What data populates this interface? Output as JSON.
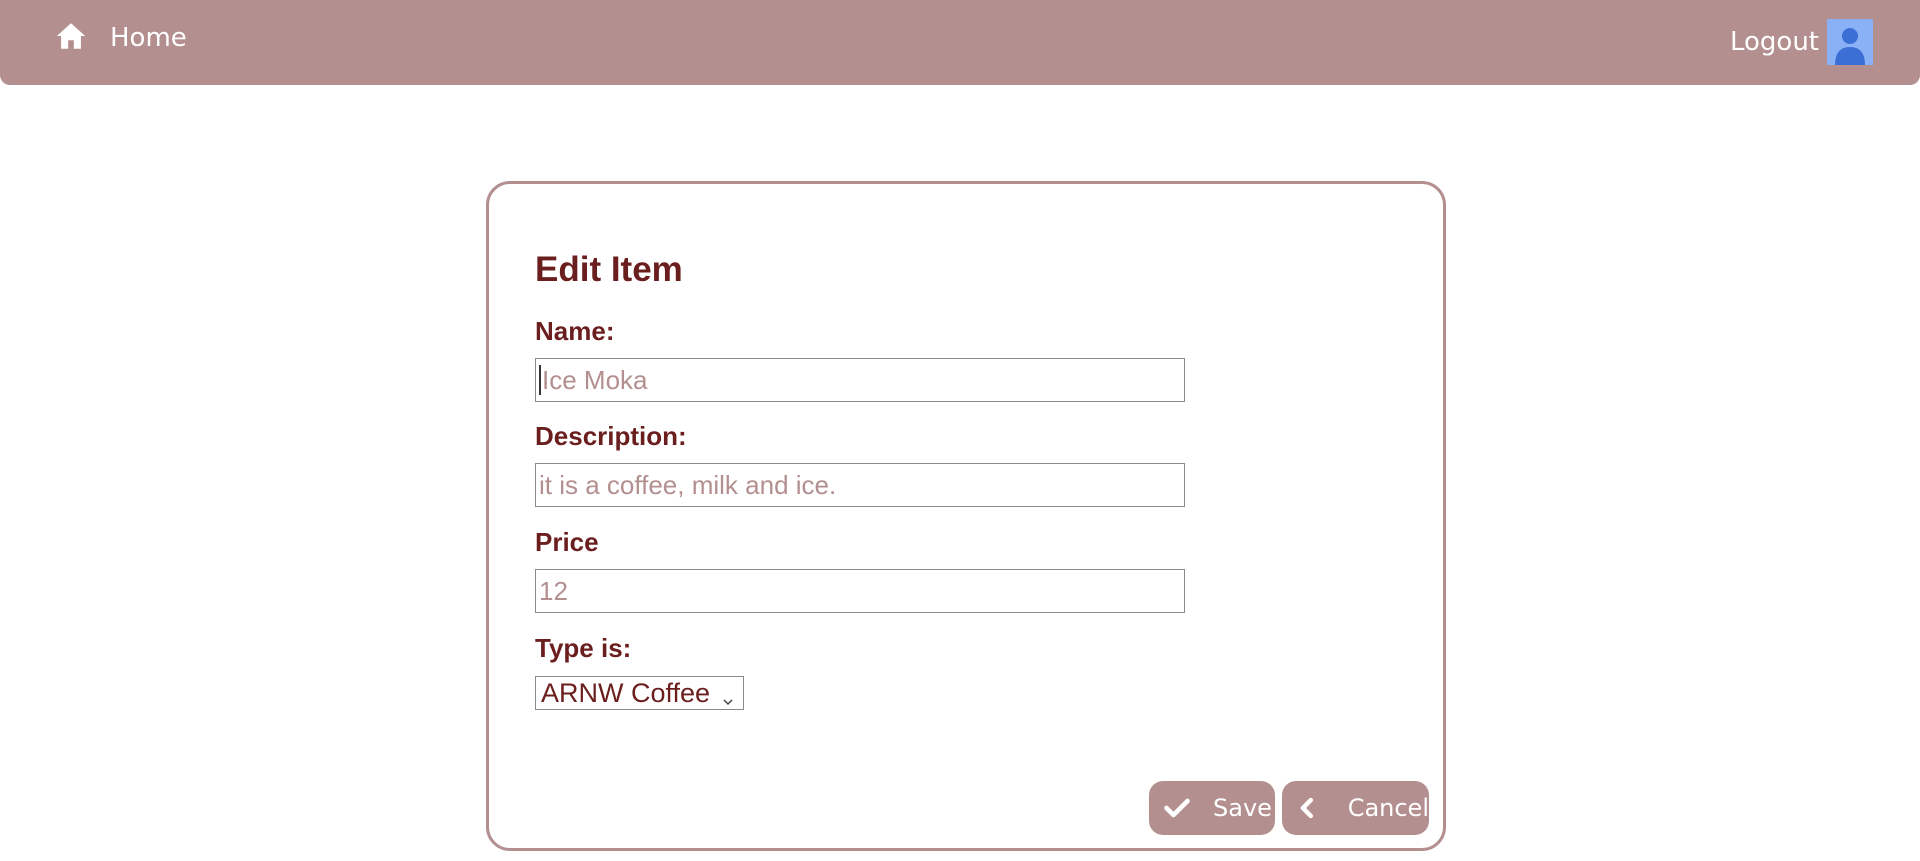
{
  "nav": {
    "home_label": "Home",
    "logout_label": "Logout",
    "home_icon": "home-icon",
    "avatar_icon": "user-avatar-icon"
  },
  "form": {
    "title": "Edit Item",
    "name_label": "Name:",
    "name_value": "Ice Moka",
    "description_label": "Description:",
    "description_value": "it is a coffee, milk and ice.",
    "price_label": "Price",
    "price_value": "12",
    "type_label": "Type is:",
    "type_selected": "ARNW Coffee"
  },
  "actions": {
    "save_label": "Save",
    "save_icon": "check-icon",
    "cancel_label": "Cancel",
    "cancel_icon": "chevron-left-icon"
  },
  "colors": {
    "brand": "#b3908f",
    "text_dark": "#6b1e1e",
    "avatar_bg": "#8ab0f5",
    "avatar_fg": "#3b6fd6"
  }
}
